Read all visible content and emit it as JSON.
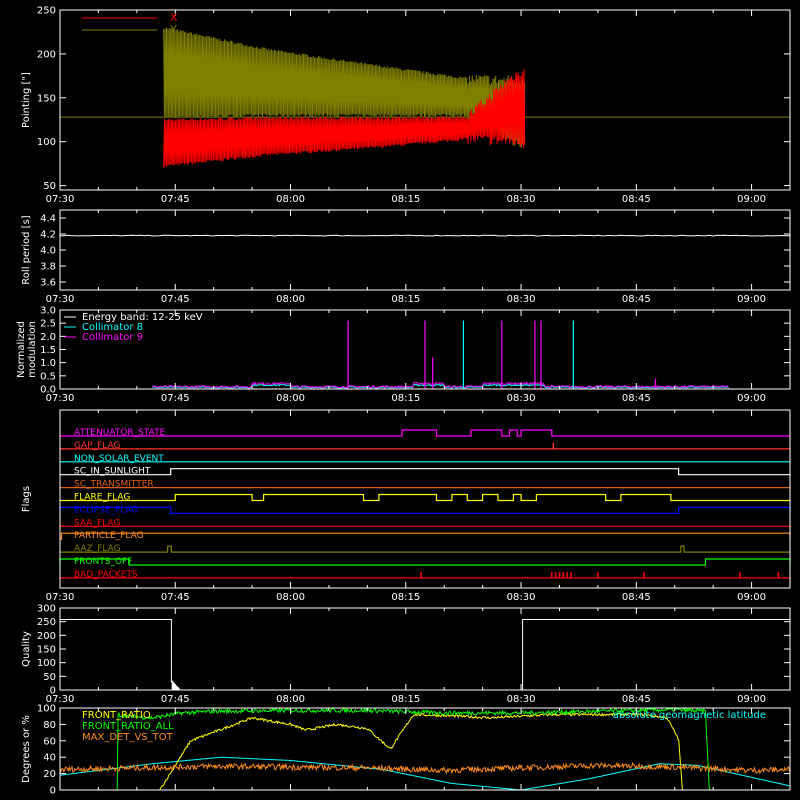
{
  "colors": {
    "background": "#000000",
    "axes": "#ffffff",
    "red": "#ff0000",
    "olive": "#808000",
    "cyan": "#00ffff",
    "magenta": "#ff00ff",
    "yellow": "#ffff00",
    "green": "#00ff00",
    "orange": "#ff8c1a",
    "blue": "#0000ff",
    "mid_red": "#ff3030",
    "dark_orange": "#e06010"
  },
  "time_axis": {
    "start_minutes": 450,
    "end_minutes": 545,
    "tick_minutes": [
      450,
      465,
      480,
      495,
      510,
      525,
      540
    ],
    "tick_labels": [
      "07:30",
      "07:45",
      "08:00",
      "08:15",
      "08:30",
      "08:45",
      "09:00"
    ]
  },
  "chart_data": [
    {
      "type": "line",
      "ylabel": "Pointing [\"]",
      "ylim": [
        45,
        250
      ],
      "yticks": [
        50,
        100,
        150,
        200,
        250
      ],
      "legend": [
        {
          "name": "X",
          "color": "#ff0000"
        },
        {
          "name": "Y",
          "color": "#808000"
        }
      ],
      "reference_line": 128,
      "series": [
        {
          "name": "X",
          "color": "#ff0000",
          "x_minutes": [
            463.5,
            477,
            490,
            503,
            509,
            510.5
          ],
          "min": [
            72,
            85,
            93,
            103,
            100,
            97
          ],
          "max": [
            125,
            127,
            127,
            128,
            175,
            182
          ]
        },
        {
          "name": "Y",
          "color": "#808000",
          "x_minutes": [
            463.5,
            477,
            490,
            503,
            509,
            510.5
          ],
          "min": [
            128,
            130,
            130,
            130,
            100,
            98
          ],
          "max": [
            230,
            205,
            188,
            172,
            170,
            168
          ]
        }
      ]
    },
    {
      "type": "line",
      "ylabel": "Roll period [s]",
      "ylim": [
        3.5,
        4.5
      ],
      "yticks": [
        3.6,
        3.8,
        4.0,
        4.2,
        4.4
      ],
      "ytick_labels": [
        "3.6",
        "3.8",
        "4.0",
        "4.2",
        "4.4"
      ],
      "series": [
        {
          "name": "roll",
          "x_minutes": [
            450,
            545
          ],
          "y": [
            4.18,
            4.18
          ]
        }
      ]
    },
    {
      "type": "line",
      "ylabel": "Normalized modulation",
      "ylim": [
        0,
        3.0
      ],
      "yticks": [
        0.0,
        0.5,
        1.0,
        1.5,
        2.0,
        2.5,
        3.0
      ],
      "ytick_labels": [
        "0.0",
        "0.5",
        "1.0",
        "1.5",
        "2.0",
        "2.5",
        "3.0"
      ],
      "legend": [
        {
          "name": "Energy band: 12-25 keV",
          "color": "#ffffff"
        },
        {
          "name": "Collimator 8",
          "color": "#00ffff"
        },
        {
          "name": "Collimator 9",
          "color": "#ff00ff"
        }
      ],
      "data_start": 462,
      "data_end": 537,
      "spikes": [
        {
          "x": 487.5,
          "y": 2.6,
          "color": "#ff00ff"
        },
        {
          "x": 497.5,
          "y": 2.6,
          "color": "#ff00ff"
        },
        {
          "x": 498.5,
          "y": 1.2,
          "color": "#ff00ff"
        },
        {
          "x": 502.5,
          "y": 2.6,
          "color": "#00ffff"
        },
        {
          "x": 507.5,
          "y": 2.6,
          "color": "#ff00ff"
        },
        {
          "x": 511.8,
          "y": 2.6,
          "color": "#ff00ff"
        },
        {
          "x": 512.6,
          "y": 2.6,
          "color": "#ff00ff"
        },
        {
          "x": 516.8,
          "y": 2.6,
          "color": "#00ffff"
        },
        {
          "x": 527.5,
          "y": 0.4,
          "color": "#ff00ff"
        }
      ]
    },
    {
      "type": "table",
      "ylabel": "Flags",
      "flags": [
        {
          "name": "ATTENUATOR_STATE",
          "color": "#ff00ff",
          "high": [
            [
              494.5,
              499
            ],
            [
              503.5,
              507.5
            ],
            [
              508.5,
              509.5
            ],
            [
              510,
              514
            ]
          ]
        },
        {
          "name": "GAP_FLAG",
          "color": "#ff3030",
          "ticks": [
            514.2
          ]
        },
        {
          "name": "NON_SOLAR_EVENT",
          "color": "#00ffff",
          "high": []
        },
        {
          "name": "SC_IN_SUNLIGHT",
          "color": "#ffffff",
          "high": [
            [
              464.4,
              530.5
            ]
          ]
        },
        {
          "name": "SC_TRANSMITTER",
          "color": "#e06010",
          "high": []
        },
        {
          "name": "FLARE_FLAG",
          "color": "#ffff00",
          "high": [
            [
              465,
              475
            ],
            [
              476.5,
              489.5
            ],
            [
              491.5,
              499
            ],
            [
              501,
              503
            ],
            [
              505,
              507
            ],
            [
              509,
              510
            ],
            [
              512,
              521
            ],
            [
              523,
              529.5
            ]
          ]
        },
        {
          "name": "ECLIPSE_FLAG",
          "color": "#0000ff",
          "high": [
            [
              450,
              464.4
            ],
            [
              530.5,
              545
            ]
          ]
        },
        {
          "name": "SAA_FLAG",
          "color": "#ff0000",
          "high": []
        },
        {
          "name": "PARTICLE_FLAG",
          "color": "#ff8c1a",
          "high": [
            [
              450.2,
              545
            ]
          ]
        },
        {
          "name": "AAZ_FLAG",
          "color": "#808000",
          "high": [
            [
              464,
              464.5
            ],
            [
              530.8,
              531.2
            ]
          ]
        },
        {
          "name": "FRONTS_OFF",
          "color": "#00ff00",
          "high": [
            [
              450,
              459
            ],
            [
              534,
              545
            ]
          ]
        },
        {
          "name": "BAD_PACKETS",
          "color": "#ff0000",
          "ticks": [
            497,
            514,
            514.5,
            515,
            515.5,
            516,
            516.5,
            520,
            526,
            538.5,
            543.5
          ]
        }
      ]
    },
    {
      "type": "line",
      "ylabel": "Quality",
      "ylim": [
        0,
        300
      ],
      "yticks": [
        0,
        50,
        100,
        150,
        200,
        250,
        300
      ],
      "series": [
        {
          "name": "quality",
          "x_minutes": [
            450,
            464.5,
            464.5,
            465.5,
            465.5,
            510.2,
            510.2,
            545
          ],
          "y": [
            258,
            258,
            30,
            5,
            0,
            0,
            258,
            258
          ]
        }
      ]
    },
    {
      "type": "line",
      "ylabel": "Degrees or %",
      "ylim": [
        0,
        100
      ],
      "yticks": [
        0,
        20,
        40,
        60,
        80,
        100
      ],
      "legend": [
        {
          "name": "FRONT_RATIO",
          "color": "#ffff00"
        },
        {
          "name": "FRONT_RATIO_ALL",
          "color": "#00ff00"
        },
        {
          "name": "MAX_DET_VS_TOT",
          "color": "#ff8c1a"
        },
        {
          "name": "absolute geomagnetic latitude",
          "color": "#00ffff"
        }
      ],
      "series": [
        {
          "name": "absolute geomagnetic latitude",
          "color": "#00ffff",
          "x_minutes": [
            450,
            462,
            471,
            480,
            492,
            501,
            510,
            519,
            528,
            533,
            545
          ],
          "y": [
            18,
            32,
            40,
            36,
            25,
            8,
            0,
            14,
            32,
            30,
            5
          ]
        },
        {
          "name": "FRONT_RATIO",
          "color": "#ffff00",
          "x_minutes": [
            450,
            463,
            467,
            475,
            480,
            482,
            486,
            490,
            493,
            496,
            502,
            506,
            510,
            514,
            520,
            526,
            529,
            530.5,
            531,
            545
          ],
          "y": [
            0,
            0,
            60,
            88,
            80,
            73,
            80,
            75,
            50,
            92,
            90,
            88,
            90,
            92,
            92,
            92,
            88,
            62,
            0,
            0
          ]
        },
        {
          "name": "FRONT_RATIO_ALL",
          "color": "#00ff00",
          "x_minutes": [
            450,
            457.5,
            457.5,
            459,
            462,
            466,
            470,
            480,
            490,
            500,
            510,
            520,
            530,
            534,
            534.5,
            545
          ],
          "y": [
            0,
            0,
            92,
            90,
            88,
            94,
            96,
            97,
            97,
            94,
            94,
            96,
            98,
            96,
            0,
            0
          ]
        },
        {
          "name": "MAX_DET_VS_TOT",
          "color": "#ff8c1a",
          "x_minutes": [
            450,
            460,
            470,
            480,
            490,
            500,
            510,
            520,
            530,
            540,
            545
          ],
          "y": [
            25,
            27,
            29,
            28,
            27,
            24,
            27,
            30,
            28,
            24,
            25
          ]
        }
      ]
    }
  ]
}
